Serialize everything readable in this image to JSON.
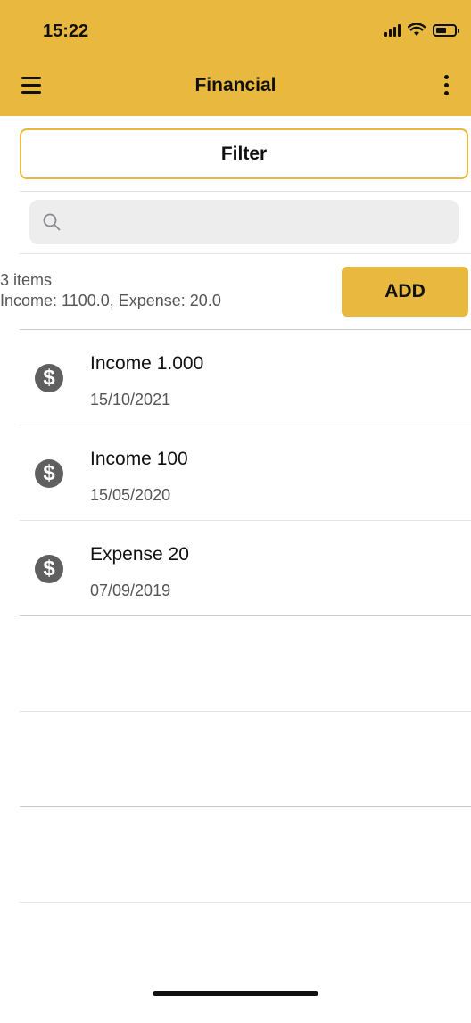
{
  "status_bar": {
    "time": "15:22"
  },
  "header": {
    "title": "Financial",
    "menu_icon": "hamburger-menu-icon",
    "more_icon": "more-vertical-icon",
    "background_color": "#e8b83f"
  },
  "filter": {
    "label": "Filter"
  },
  "search": {
    "placeholder": "",
    "value": ""
  },
  "summary": {
    "count_text": "3 items",
    "totals_text": "Income: 1100.0, Expense: 20.0"
  },
  "add_button": {
    "label": "ADD"
  },
  "transactions": [
    {
      "title": "Income 1.000",
      "date": "15/10/2021",
      "icon": "dollar-icon"
    },
    {
      "title": "Income 100",
      "date": "15/05/2020",
      "icon": "dollar-icon"
    },
    {
      "title": "Expense 20",
      "date": "07/09/2019",
      "icon": "dollar-icon"
    }
  ],
  "colors": {
    "accent": "#e8b83f",
    "icon_gray": "#5f5f5f"
  }
}
